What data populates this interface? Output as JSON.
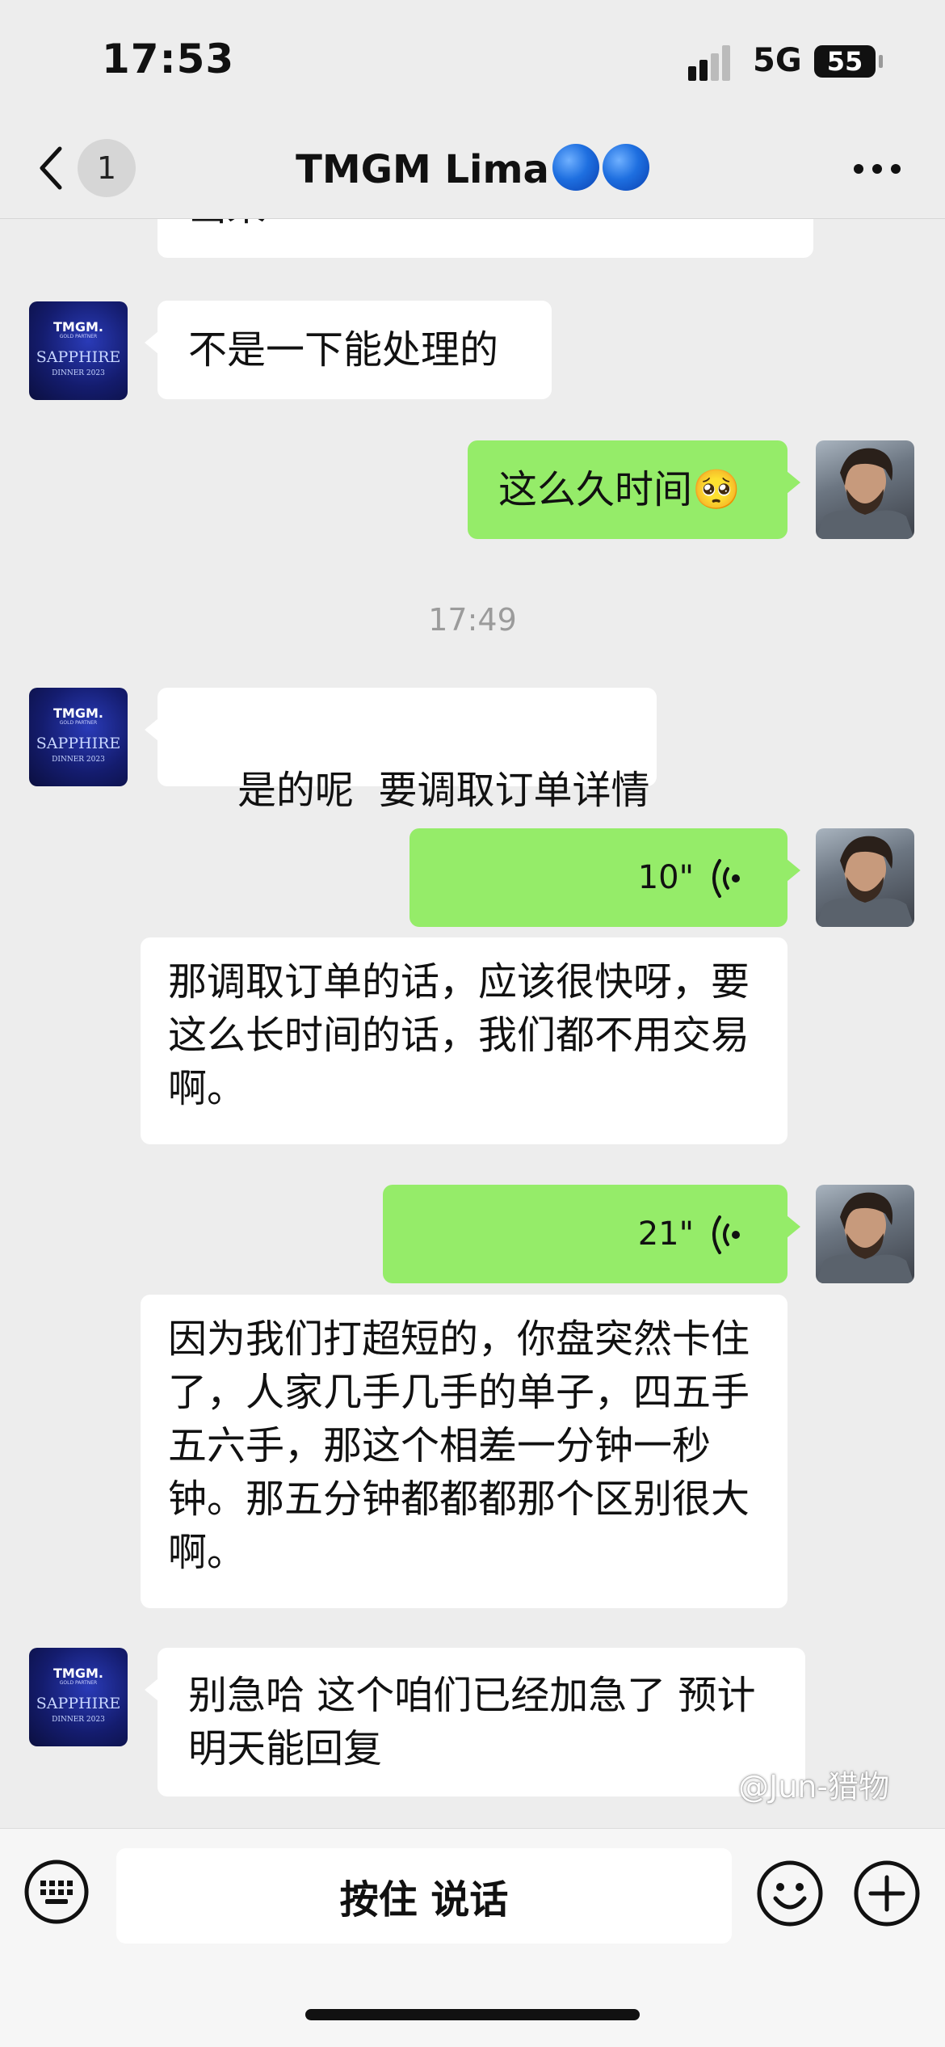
{
  "status_bar": {
    "time": "17:53",
    "network": "5G",
    "battery": "55"
  },
  "header": {
    "back_count": "1",
    "title": "TMGM Lima"
  },
  "avatar_contact": {
    "logo": "TMGM.",
    "logo_sub": "GOLD PARTNER",
    "brand": "SAPPHIRE",
    "sub": "DINNER 2023"
  },
  "messages": [
    {
      "side": "in",
      "text": "出来"
    },
    {
      "side": "in",
      "text": "不是一下能处理的"
    },
    {
      "side": "out",
      "text": "这么久时间🥺"
    },
    {
      "side": "time",
      "text": "17:49"
    },
    {
      "side": "in",
      "text": "是的呢  要调取订单详情"
    },
    {
      "side": "out",
      "voice": "10\"",
      "transcript": "那调取订单的话，应该很快呀，要这么长时间的话，我们都不用交易啊。"
    },
    {
      "side": "out",
      "voice": "21\"",
      "transcript": "因为我们打超短的，你盘突然卡住了，人家几手几手的单子，四五手五六手，那这个相差一分钟一秒钟。那五分钟都都都那个区别很大啊。"
    },
    {
      "side": "in",
      "text": "别急哈  这个咱们已经加急了  预计明天能回复"
    }
  ],
  "input_bar": {
    "talk_label": "按住 说话"
  },
  "watermark": "@Jun-猎物",
  "colors": {
    "outgoing": "#95ec69",
    "incoming": "#ffffff",
    "background": "#ededed"
  }
}
